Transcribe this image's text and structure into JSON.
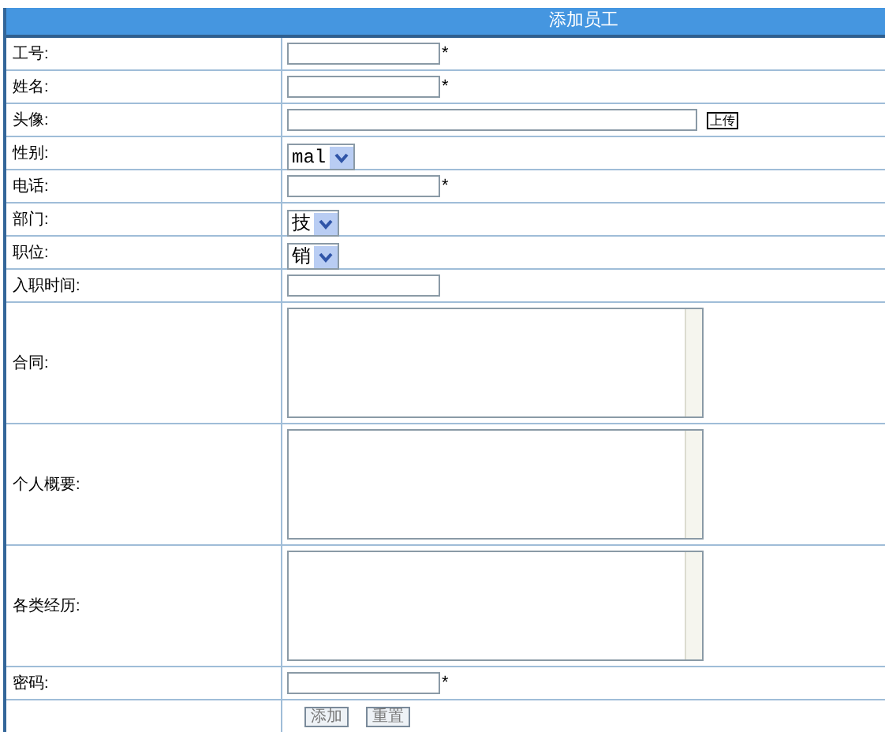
{
  "title": "添加员工",
  "fields": [
    {
      "label": "工号:",
      "kind": "text",
      "required": true
    },
    {
      "label": "姓名:",
      "kind": "text",
      "required": true
    },
    {
      "label": "头像:",
      "kind": "file",
      "button": "上传"
    },
    {
      "label": "性别:",
      "kind": "select",
      "value": "mal"
    },
    {
      "label": "电话:",
      "kind": "text",
      "required": true
    },
    {
      "label": "部门:",
      "kind": "select",
      "value": "技"
    },
    {
      "label": "职位:",
      "kind": "select",
      "value": "销"
    },
    {
      "label": "入职时间:",
      "kind": "text",
      "required": false
    },
    {
      "label": "合同:",
      "kind": "textarea"
    },
    {
      "label": "个人概要:",
      "kind": "textarea"
    },
    {
      "label": "各类经历:",
      "kind": "textarea"
    },
    {
      "label": "密码:",
      "kind": "password",
      "required": true
    }
  ],
  "required_mark": "*",
  "buttons": [
    "添加",
    "重置"
  ]
}
